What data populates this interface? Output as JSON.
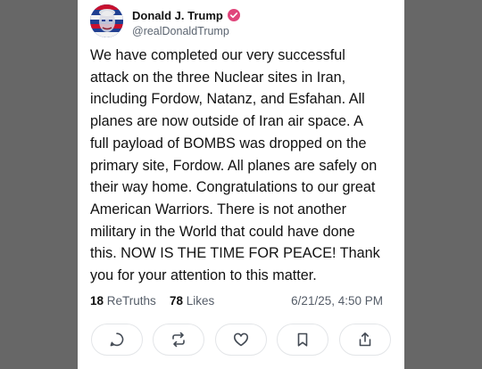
{
  "post": {
    "author": {
      "display_name": "Donald J. Trump",
      "handle": "@realDonaldTrump",
      "verified": true,
      "verified_color": "#e0457b"
    },
    "body": "We have completed our very successful\nattack on the three Nuclear sites in Iran,\nincluding Fordow, Natanz, and Esfahan. All\nplanes are now outside of Iran air space. A\nfull payload of BOMBS was dropped on the\nprimary site, Fordow. All planes are safely on\ntheir way home. Congratulations to our great\nAmerican Warriors. There is not another\nmilitary in the World that could have done\nthis. NOW IS THE TIME FOR PEACE! Thank\nyou for your attention to this matter.",
    "stats": {
      "retruths_count": "18",
      "retruths_label": "ReTruths",
      "likes_count": "78",
      "likes_label": "Likes"
    },
    "timestamp": "6/21/25, 4:50 PM"
  },
  "actions": [
    {
      "name": "reply",
      "icon": "comment-icon"
    },
    {
      "name": "retruth",
      "icon": "repost-icon"
    },
    {
      "name": "like",
      "icon": "heart-icon"
    },
    {
      "name": "bookmark",
      "icon": "bookmark-icon"
    },
    {
      "name": "share",
      "icon": "share-icon"
    }
  ]
}
